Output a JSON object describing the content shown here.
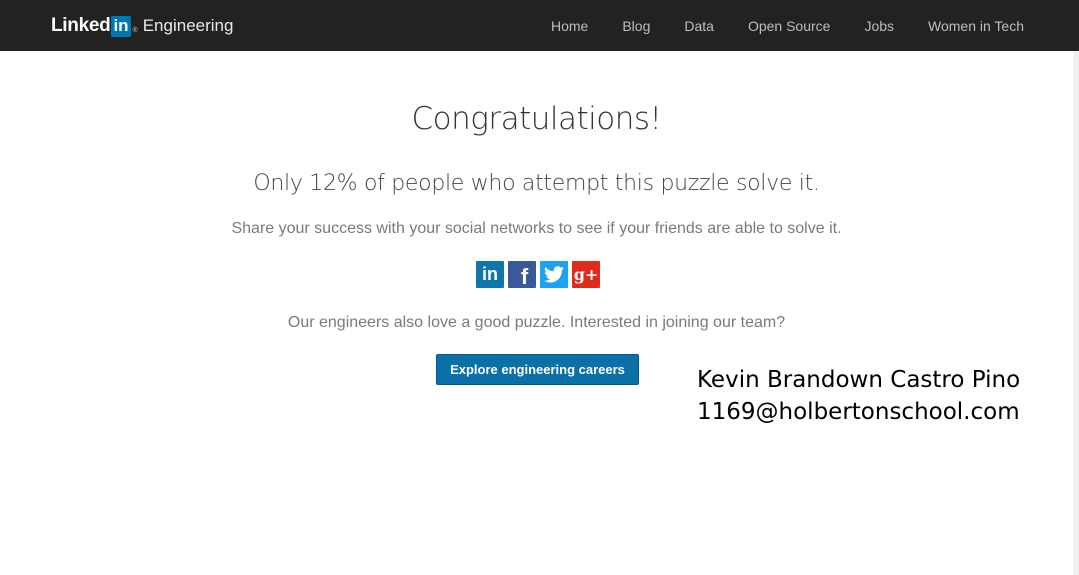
{
  "header": {
    "brand_linked": "Linked",
    "brand_in": "in",
    "brand_reg": "®",
    "brand_section": "Engineering",
    "nav": [
      "Home",
      "Blog",
      "Data",
      "Open Source",
      "Jobs",
      "Women in Tech"
    ]
  },
  "main": {
    "title": "Congratulations!",
    "subtitle": "Only 12% of people who attempt this puzzle solve it.",
    "share_text": "Share your success with your social networks to see if your friends are able to solve it.",
    "social_icons": [
      "linkedin-icon",
      "facebook-icon",
      "twitter-icon",
      "google-plus-icon"
    ],
    "social_glyphs": {
      "linkedin": "in",
      "facebook": "f",
      "google": "g+"
    },
    "join_text": "Our engineers also love a good puzzle. Interested in joining our team?",
    "cta_label": "Explore engineering careers"
  },
  "signature": {
    "name": "Kevin Brandown Castro Pino",
    "email": "1169@holbertonschool.com"
  },
  "colors": {
    "topbar": "#222222",
    "accent": "#0a70a7",
    "linkedin": "#0e76a8",
    "facebook": "#3b5998",
    "twitter": "#1da1f2",
    "google": "#dd2c1b"
  }
}
